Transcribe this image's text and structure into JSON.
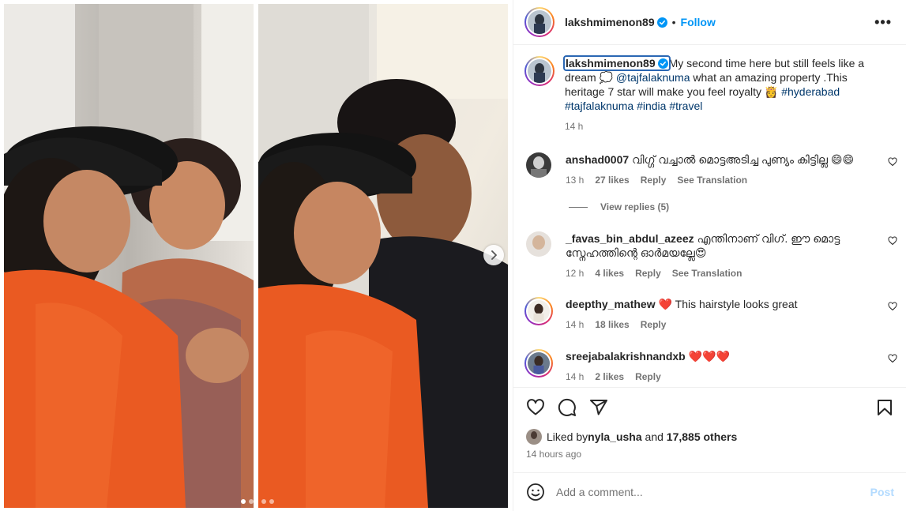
{
  "post": {
    "username": "lakshmimenon89",
    "follow_label": "Follow",
    "separator": "•",
    "more_label": "•••",
    "caption": {
      "username": "lakshmimenon89",
      "text_1": "My second time here but still feels like a dream 💭 ",
      "mention": "@tajfalaknuma",
      "text_2": " what an amazing property .This heritage 7 star will make you feel royalty 👸 ",
      "hashtag_1": "#hyderabad",
      "hashtag_2": "#tajfalaknuma",
      "hashtag_3": "#india",
      "hashtag_4": "#travel",
      "time": "14 h"
    },
    "comments": [
      {
        "username": "anshad0007",
        "text": "വിഗ്ഗ് വച്ചാൽ മൊട്ടഅടിച്ച പുണ്യം കിട്ടില്ല 😄😄",
        "time": "13 h",
        "likes": "27 likes",
        "reply": "Reply",
        "translation": "See Translation"
      },
      {
        "username": "_favas_bin_abdul_azeez",
        "text": "എന്തിനാണ് വിഗ്. ഈ മൊട്ട സ്നേഹത്തിന്റെ ഓർമയല്ലേ😍",
        "time": "12 h",
        "likes": "4 likes",
        "reply": "Reply",
        "translation": "See Translation"
      },
      {
        "username": "deepthy_mathew",
        "text": "❤️ This hairstyle looks great",
        "time": "14 h",
        "likes": "18 likes",
        "reply": "Reply"
      },
      {
        "username": "sreejabalakrishnandxb",
        "text": "❤️❤️❤️",
        "time": "14 h",
        "likes": "2 likes",
        "reply": "Reply"
      }
    ],
    "view_replies": "View replies (5)",
    "liked_by": {
      "prefix": "Liked by ",
      "user": "nyla_usha",
      "middle": " and ",
      "others": "17,885 others"
    },
    "time_ago": "14 hours ago",
    "add_comment_placeholder": "Add a comment...",
    "post_label": "Post"
  },
  "icons": {
    "like": "heart-icon",
    "comment": "comment-icon",
    "share": "share-icon",
    "save": "bookmark-icon",
    "emoji": "emoji-icon",
    "next": "chevron-right-icon",
    "verified": "verified-badge-icon",
    "more": "more-options-icon"
  },
  "colors": {
    "accent": "#0095f6",
    "link": "#00376b",
    "muted": "#737373",
    "post_disabled": "#b3dbff"
  },
  "carousel": {
    "slide_count": 4,
    "active_index": 0
  }
}
